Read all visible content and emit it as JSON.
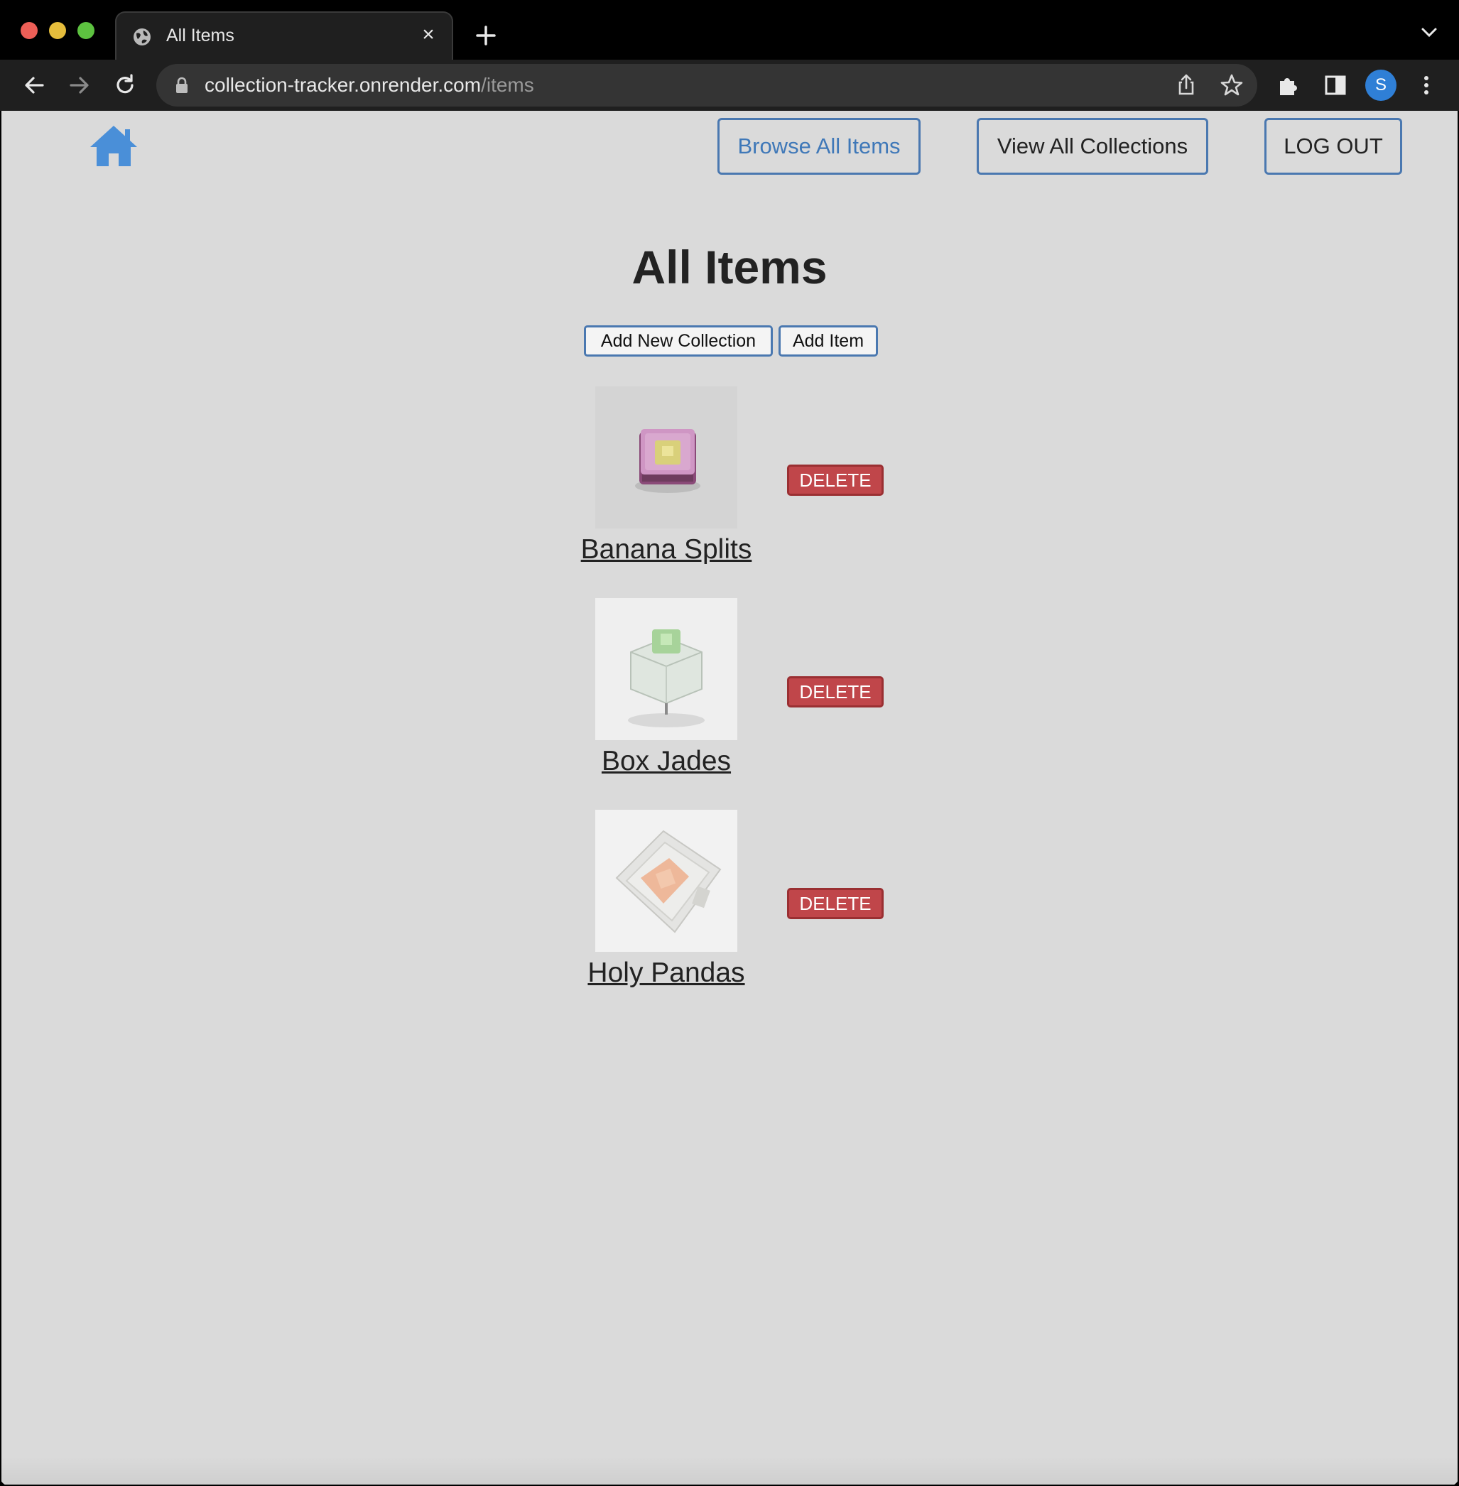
{
  "browser": {
    "tab_title": "All Items",
    "url_host": "collection-tracker.onrender.com",
    "url_path": "/items",
    "avatar_initial": "S"
  },
  "nav": {
    "browse_label": "Browse All Items",
    "collections_label": "View All Collections",
    "logout_label": "LOG OUT"
  },
  "main": {
    "title": "All Items",
    "add_collection_label": "Add New Collection",
    "add_item_label": "Add Item",
    "items": [
      {
        "name": "Banana Splits",
        "delete_label": "DELETE"
      },
      {
        "name": "Box Jades",
        "delete_label": "DELETE"
      },
      {
        "name": "Holy Pandas",
        "delete_label": "DELETE"
      }
    ]
  },
  "colors": {
    "accent": "#4a78b0",
    "delete": "#c0464a",
    "page_bg": "#dadada"
  }
}
